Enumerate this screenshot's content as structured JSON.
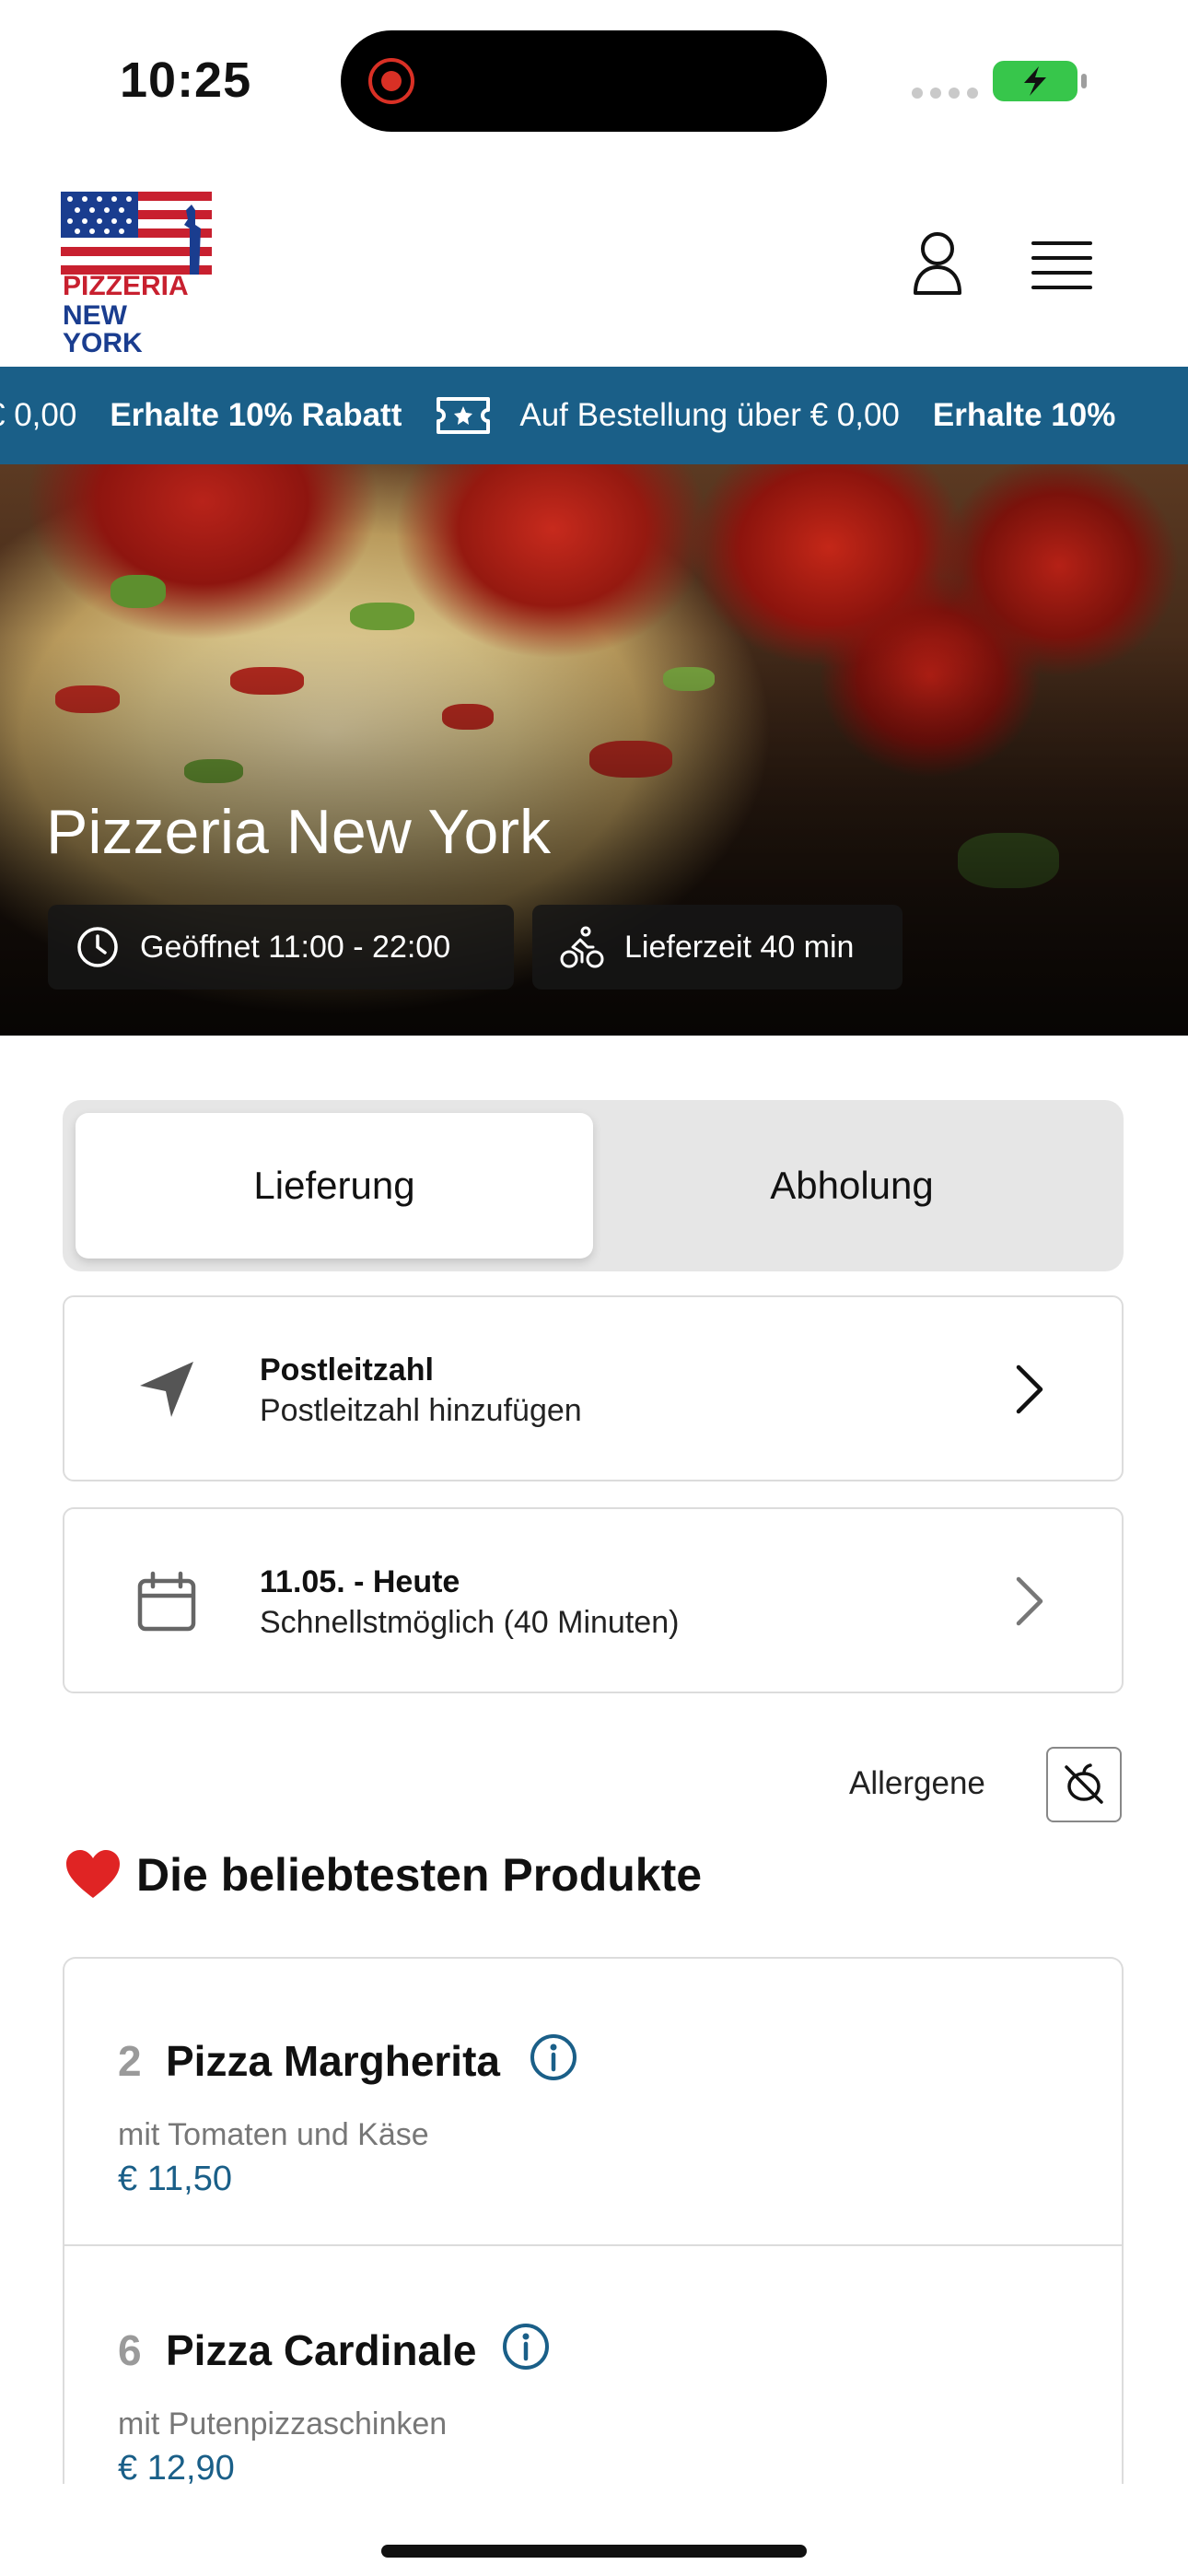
{
  "status_bar": {
    "time": "10:25"
  },
  "header": {
    "logo_line1": "PIZZERIA",
    "logo_line2": "NEW YORK",
    "user_icon": "person-icon",
    "menu_icon": "hamburger-icon"
  },
  "ticker": {
    "lead_fragment": "€ 0,00",
    "discount": "Erhalte 10% Rabatt",
    "condition": "Auf Bestellung über € 0,00",
    "trail_fragment": "Erhalte 10%"
  },
  "hero": {
    "title": "Pizzeria New York",
    "opening_hours": "Geöffnet 11:00 - 22:00",
    "delivery_time": "Lieferzeit 40 min"
  },
  "order_mode": {
    "options": [
      "Lieferung",
      "Abholung"
    ],
    "selected": "Lieferung"
  },
  "zip_card": {
    "title": "Postleitzahl",
    "subtitle": "Postleitzahl hinzufügen"
  },
  "date_card": {
    "title": "11.05. - Heute",
    "subtitle": "Schnellstmöglich (40 Minuten)"
  },
  "allergens": {
    "label": "Allergene"
  },
  "popular": {
    "title": "Die beliebtesten Produkte",
    "products": [
      {
        "number": "2",
        "name": "Pizza Margherita",
        "description": "mit Tomaten und Käse",
        "price": "€ 11,50"
      },
      {
        "number": "6",
        "name": "Pizza Cardinale",
        "description": "mit Putenpizzaschinken",
        "price": "€ 12,90"
      }
    ]
  },
  "colors": {
    "accent": "#1a5f88",
    "ticker_bg": "#1a5f88",
    "battery": "#37c64b"
  }
}
